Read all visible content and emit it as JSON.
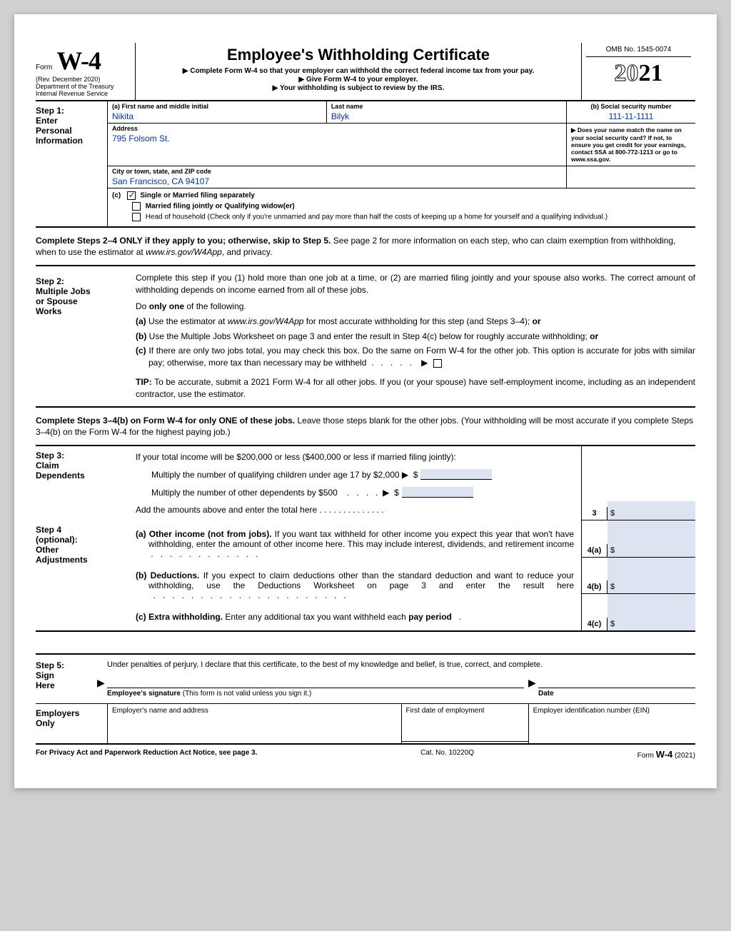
{
  "header": {
    "form_label": "Form",
    "form_name": "W-4",
    "rev": "(Rev. December 2020)",
    "dept": "Department of the Treasury",
    "irs": "Internal Revenue Service",
    "title": "Employee's Withholding Certificate",
    "inst1": "▶ Complete Form W-4 so that your employer can withhold the correct federal income tax from your pay.",
    "inst2": "▶ Give Form W-4 to your employer.",
    "inst3": "▶ Your withholding is subject to review by the IRS.",
    "omb": "OMB No. 1545-0074",
    "year_outline": "20",
    "year_bold": "21"
  },
  "step1": {
    "label_line1": "Step 1:",
    "label_line2": "Enter",
    "label_line3": "Personal",
    "label_line4": "Information",
    "a_label": "(a)   First name and middle initial",
    "first_name": "Nikita",
    "last_label": "Last name",
    "last_name": "Bilyk",
    "b_label": "(b)   Social security number",
    "ssn": "111-11-1111",
    "addr_label": "Address",
    "address": "795 Folsom St.",
    "city_label": "City or town, state, and ZIP code",
    "city": "San Francisco, CA 94107",
    "right_note": "▶ Does your name match the name on your social security card? If not, to ensure you get credit for your earnings, contact SSA at 800-772-1213 or go to www.ssa.gov.",
    "c_label": "(c)",
    "fs1": "Single or Married filing separately",
    "fs2": "Married filing jointly or Qualifying widow(er)",
    "fs3": "Head of household (Check only if you're unmarried and pay more than half the costs of keeping up a home for yourself and a qualifying individual.)"
  },
  "intro24": "Complete Steps 2–4 ONLY if they apply to you; otherwise, skip to Step 5. See page 2 for more information on each step, who can claim exemption from withholding, when to use the estimator at www.irs.gov/W4App, and privacy.",
  "step2": {
    "label": "Step 2:\nMultiple Jobs\nor Spouse\nWorks",
    "label1": "Step 2:",
    "label2": "Multiple Jobs",
    "label3": "or Spouse",
    "label4": "Works",
    "p1": "Complete this step if you (1) hold more than one job at a time, or (2) are married filing jointly and your spouse also works. The correct amount of withholding depends on income earned from all of these jobs.",
    "p2": "Do only one of the following.",
    "a": "(a) Use the estimator at www.irs.gov/W4App for most accurate withholding for this step (and Steps 3–4); or",
    "b": "(b) Use the Multiple Jobs Worksheet on page 3 and enter the result in Step 4(c) below for roughly accurate withholding; or",
    "c": "(c) If there are only two jobs total, you may check this box. Do the same on Form W-4 for the other job. This option is accurate for jobs with similar pay; otherwise, more tax than necessary may be withheld  .    .    .    .    .    ▶",
    "tip": "TIP: To be accurate, submit a 2021 Form W-4 for all other jobs. If you (or your spouse) have self-employment income, including as an independent contractor, use the estimator."
  },
  "intro34": "Complete Steps 3–4(b) on Form W-4 for only ONE of these jobs. Leave those steps blank for the other jobs. (Your withholding will be most accurate if you complete Steps 3–4(b) on the Form W-4 for the highest paying job.)",
  "step3": {
    "label1": "Step 3:",
    "label2": "Claim",
    "label3": "Dependents",
    "p1": "If your total income will be $200,000 or less ($400,000 or less if married filing jointly):",
    "l1": "Multiply the number of qualifying children under age 17 by $2,000 ▶  $",
    "l2": "Multiply the number of other dependents by $500    .    .    .    .   ▶  $",
    "l3": "Add the amounts above and enter the total here    .    .    .    .    .    .    .    .    .    .    .    .    .    .",
    "box_num": "3",
    "box_prefix": "$"
  },
  "step4": {
    "label1": "Step 4",
    "label2": "(optional):",
    "label3": "Other",
    "label4": "Adjustments",
    "a": "(a) Other income (not from jobs). If you want tax withheld for other income you expect this year that won't have withholding, enter the amount of other income here. This may include interest, dividends, and retirement income   .    .    .    .    .    .    .    .    .    .    .    .",
    "b": "(b) Deductions. If you expect to claim deductions other than the standard deduction and want to reduce your withholding, use the Deductions Worksheet on page 3 and enter the result here    .    .    .    .    .    .    .    .    .    .    .    .    .    .    .    .    .    .    .    .    .",
    "c": "(c) Extra withholding. Enter any additional tax you want withheld each pay period    .",
    "box_a": "4(a)",
    "box_b": "4(b)",
    "box_c": "4(c)",
    "box_prefix": "$"
  },
  "step5": {
    "label1": "Step 5:",
    "label2": "Sign",
    "label3": "Here",
    "declaration": "Under penalties of perjury, I declare that this certificate, to the best of my knowledge and belief, is true, correct, and complete.",
    "sig_label": "Employee's signature (This form is not valid unless you sign it.)",
    "sig_label_bold": "Employee's signature",
    "sig_label_rest": " (This form is not valid unless you sign it.)",
    "date_label": "Date"
  },
  "employers": {
    "label1": "Employers",
    "label2": "Only",
    "name_label": "Employer's name and address",
    "date_label": "First date of employment",
    "ein_label": "Employer identification number (EIN)"
  },
  "footer": {
    "left": "For Privacy Act and Paperwork Reduction Act Notice, see page 3.",
    "center": "Cat. No. 10220Q",
    "right_pre": "Form ",
    "right_form": "W-4",
    "right_post": " (2021)"
  }
}
